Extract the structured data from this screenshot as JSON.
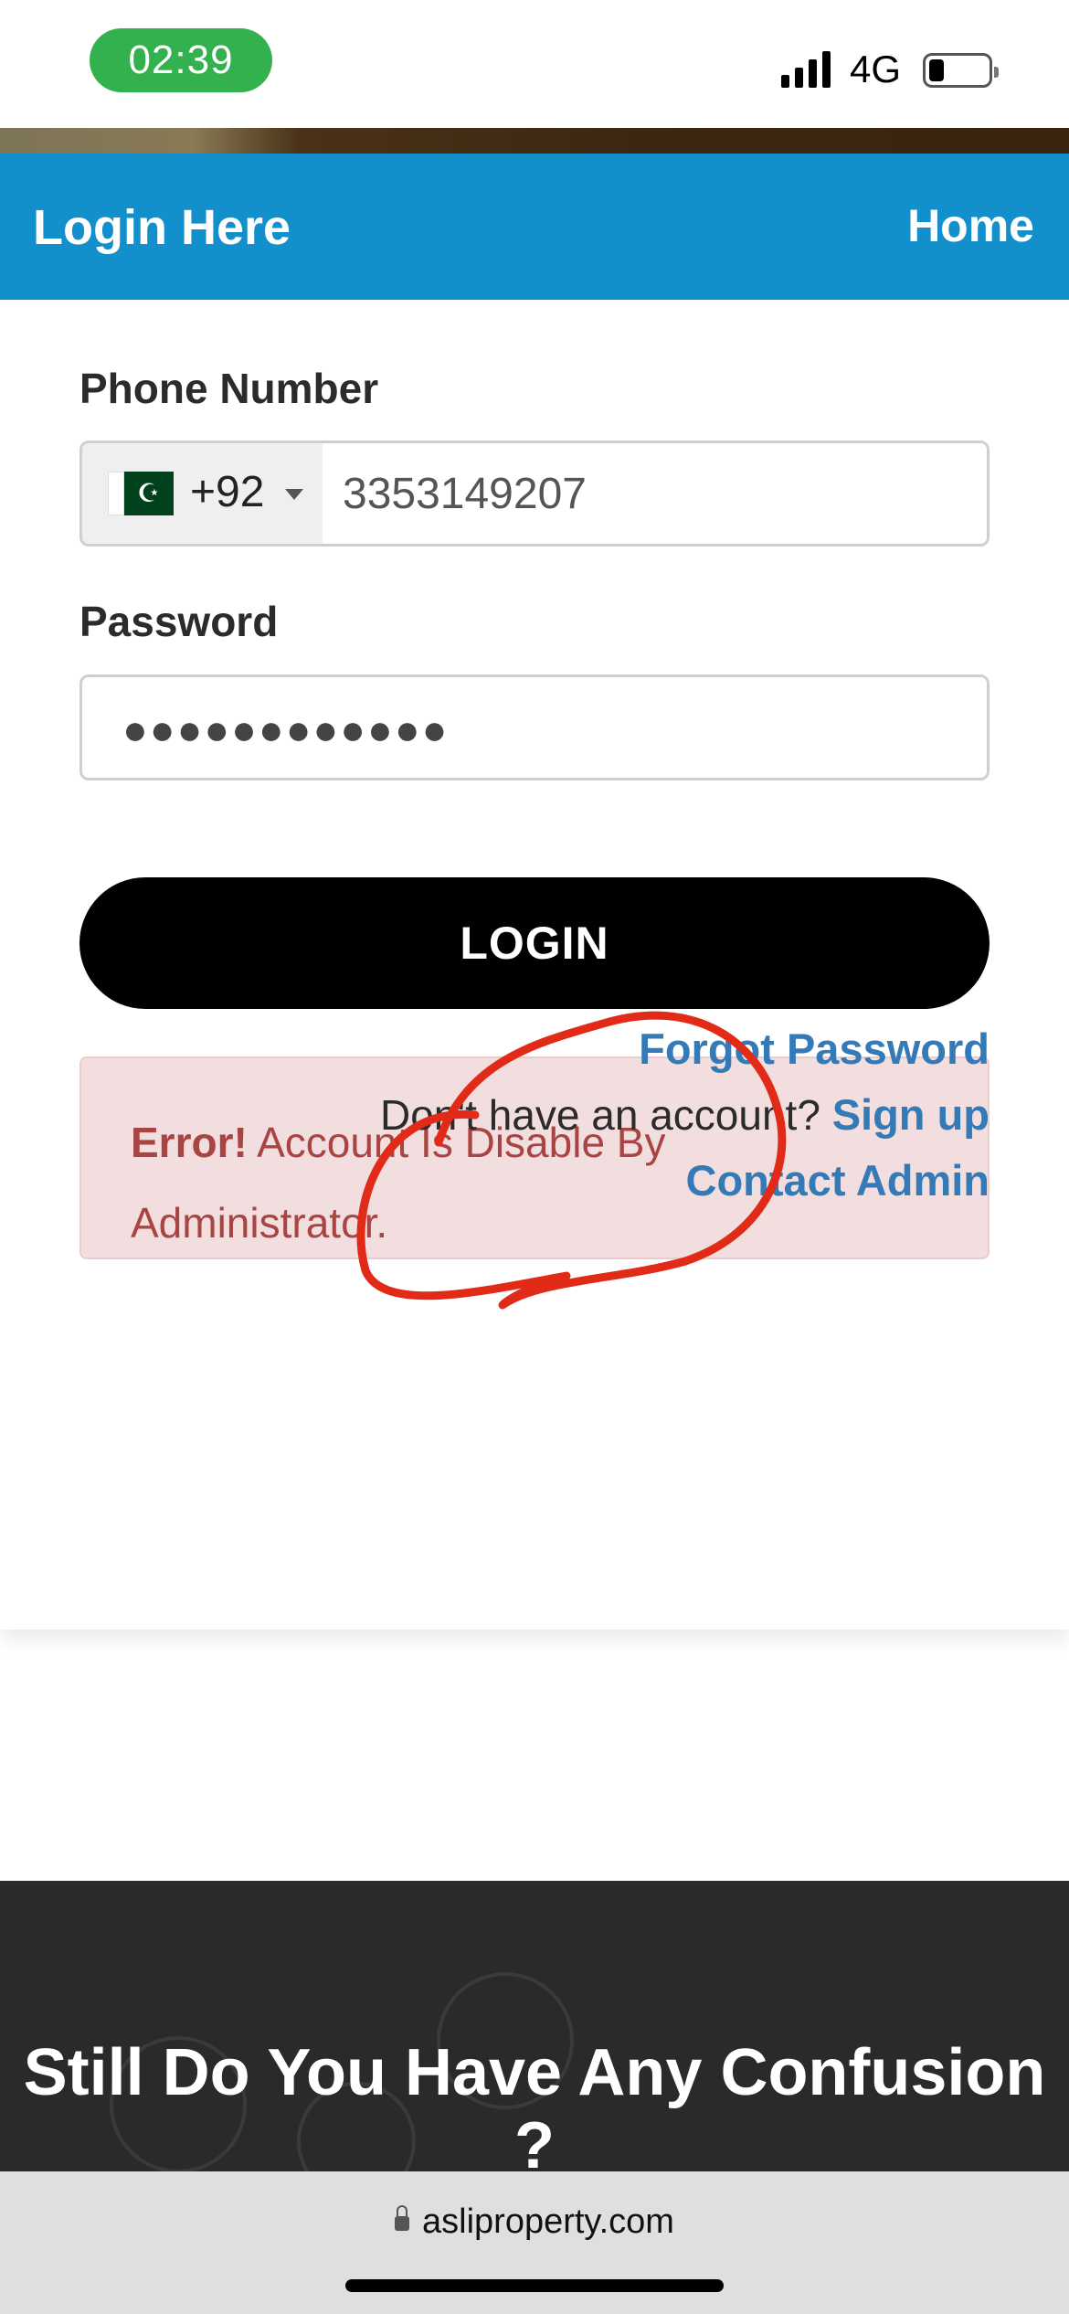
{
  "status_bar": {
    "time": "02:39",
    "network": "4G"
  },
  "header": {
    "title": "Login Here",
    "home_link": "Home"
  },
  "form": {
    "phone_label": "Phone Number",
    "country_code": "+92",
    "phone_value": "3353149207",
    "password_label": "Password",
    "password_masked": "●●●●●●●●●●●●",
    "login_button": "LOGIN"
  },
  "error": {
    "prefix": "Error!",
    "message": "Account Is Disable By Administrator."
  },
  "links": {
    "forgot_password": "Forgot Password",
    "no_account_text": "Don't have an account?",
    "sign_up": "Sign up",
    "contact_admin": "Contact Admin"
  },
  "footer": {
    "heading": "Still Do You Have Any Confusion ?"
  },
  "browser": {
    "url": "asliproperty.com"
  },
  "colors": {
    "header": "#1390cb",
    "error_bg": "#f2dede",
    "error_text": "#a94442",
    "link": "#337ab7",
    "annotation": "#e12a17"
  }
}
